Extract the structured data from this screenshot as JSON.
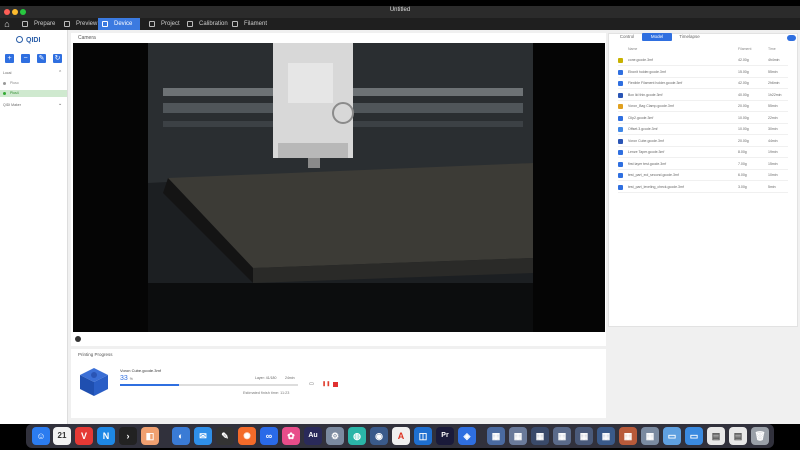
{
  "window": {
    "title": "Untitled"
  },
  "menu": {
    "items": [
      {
        "label": "Prepare"
      },
      {
        "label": "Preview"
      },
      {
        "label": "Device"
      },
      {
        "label": "Project"
      },
      {
        "label": "Calibration"
      },
      {
        "label": "Filament"
      }
    ],
    "active": "Device"
  },
  "sidebar": {
    "logo": "QIDI",
    "group_label": "Local",
    "printers": [
      {
        "name": "Pluso"
      },
      {
        "name": "Plus4"
      }
    ],
    "group2_label": "QIDI Maker"
  },
  "camera": {
    "label": "Camera"
  },
  "progress": {
    "title": "Printing Progress",
    "file": "Voron Cube.gcode.3mf",
    "percent": "33",
    "percent_unit": "%",
    "percent_value": 0.33,
    "layer": "Layer: 41/180",
    "remaining": "24min",
    "eta": "Estimated finish time: 11:23"
  },
  "right_panel": {
    "tabs": [
      {
        "label": "Control"
      },
      {
        "label": "Model"
      },
      {
        "label": "Timelapse"
      }
    ],
    "active_tab": "Model",
    "columns": [
      "Name",
      "Filament",
      "Time"
    ],
    "files": [
      {
        "name": "cone.gcode.3mf",
        "weight": "42.00g",
        "time": "4h4min",
        "color": "#c8b200"
      },
      {
        "name": "Ebonit holder.gcode.3mf",
        "weight": "15.00g",
        "time": "55min",
        "color": "#2f6fe0"
      },
      {
        "name": "Flexible Filament holder.gcode.3mf",
        "weight": "42.00g",
        "time": "2h6min",
        "color": "#2f6fe0"
      },
      {
        "name": "Box lid thin.gcode.3mf",
        "weight": "40.00g",
        "time": "1h22min",
        "color": "#2a55b5"
      },
      {
        "name": "Voron_Bag Clamp.gcode.3mf",
        "weight": "20.00g",
        "time": "55min",
        "color": "#e0a020"
      },
      {
        "name": "Clip2.gcode.3mf",
        "weight": "10.00g",
        "time": "22min",
        "color": "#2f6fe0"
      },
      {
        "name": "Offset.3.gcode.3mf",
        "weight": "10.00g",
        "time": "30min",
        "color": "#3f88e8"
      },
      {
        "name": "Voron Cube.gcode.3mf",
        "weight": "20.00g",
        "time": "44min",
        "color": "#2a55b5"
      },
      {
        "name": "Lenze Taper.gcode.3mf",
        "weight": "8.00g",
        "time": "19min",
        "color": "#2f6fe0"
      },
      {
        "name": "first layer test.gcode.3mf",
        "weight": "7.00g",
        "time": "15min",
        "color": "#2f6fe0"
      },
      {
        "name": "test_part_eol_second.gcode.3mf",
        "weight": "6.00g",
        "time": "10min",
        "color": "#2f6fe0"
      },
      {
        "name": "test_part_leveling_check.gcode.3mf",
        "weight": "3.00g",
        "time": "5min",
        "color": "#2f6fe0"
      }
    ]
  },
  "dock": {
    "calendar_day": "21"
  }
}
